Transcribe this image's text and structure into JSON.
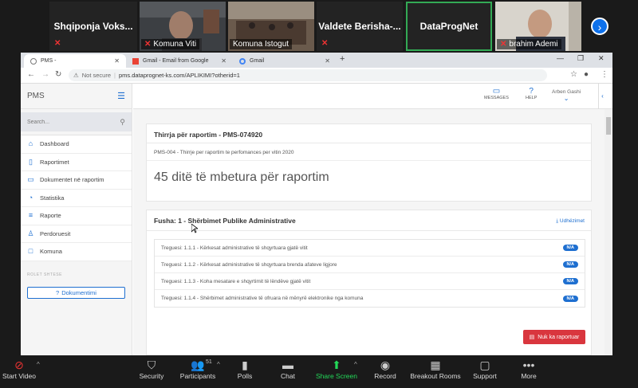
{
  "gallery": {
    "tiles": [
      {
        "name": "Shqiponja  Voks...",
        "muted": true
      },
      {
        "caption": "Komuna Viti",
        "muted": true
      },
      {
        "caption": "Komuna Istogut",
        "muted": false
      },
      {
        "name": "Valdete  Berisha-...",
        "muted": true
      },
      {
        "name": "DataProgNet",
        "muted": false
      },
      {
        "caption": "brahim Ademi",
        "muted": true
      }
    ]
  },
  "browser": {
    "tabs": [
      {
        "label": "PMS -",
        "active": true
      },
      {
        "label": "Gmail - Email from Google",
        "active": false
      },
      {
        "label": "Gmail",
        "active": false
      }
    ],
    "new_tab": "+",
    "address": {
      "security_label": "Not secure",
      "url": "pms.dataprognet-ks.com/APLIKIMI?otherid=1"
    }
  },
  "app": {
    "logo": "PMS",
    "search_placeholder": "Search...",
    "menu": [
      {
        "label": "Dashboard",
        "icon": "home-icon"
      },
      {
        "label": "Raportimet",
        "icon": "document-icon"
      },
      {
        "label": "Dokumentet në raportim",
        "icon": "folder-icon"
      },
      {
        "label": "Statistika",
        "icon": "pie-chart-icon"
      },
      {
        "label": "Raporte",
        "icon": "list-icon"
      },
      {
        "label": "Perdoruesit",
        "icon": "user-icon"
      },
      {
        "label": "Komuna",
        "icon": "square-icon"
      }
    ],
    "roles_label": "ROLET SHTESE",
    "doc_button": "Dokumentimi",
    "topbar": {
      "messages": "MESSAGES",
      "help": "HELP",
      "user": "Arben Gashi"
    },
    "report": {
      "title": "Thirrja për raportim - PMS-074920",
      "subtitle": "PMS-004 - Thirrje per raportim te perfomances per vitin 2020",
      "days_left": "45 ditë të mbetura për raportim"
    },
    "field": {
      "title": "Fusha: 1 - Shërbimet Publike Administrative",
      "guide_label": "Udhëzimet",
      "indicators": [
        {
          "label": "Treguesi: 1.1.1 - Kërkesat administrative të shqyrtuara gjatë vitit",
          "status": "N/A"
        },
        {
          "label": "Treguesi: 1.1.2 - Kërkesat administrative të shqyrtuara brenda afateve ligjore",
          "status": "N/A"
        },
        {
          "label": "Treguesi: 1.1.3 - Koha mesatare e shqyrtimit të lëndëve gjatë vitit",
          "status": "N/A"
        },
        {
          "label": "Treguesi: 1.1.4 - Shërbimet administrative të ofruara në mënyrë elektronike nga komuna",
          "status": "N/A"
        }
      ],
      "not_reported_button": "Nuk ka raportuar"
    }
  },
  "zoom_bar": {
    "start_video": "Start Video",
    "security": "Security",
    "participants": "Participants",
    "participants_count": "51",
    "polls": "Polls",
    "chat": "Chat",
    "share_screen": "Share Screen",
    "record": "Record",
    "breakout": "Breakout Rooms",
    "support": "Support",
    "more": "More"
  }
}
